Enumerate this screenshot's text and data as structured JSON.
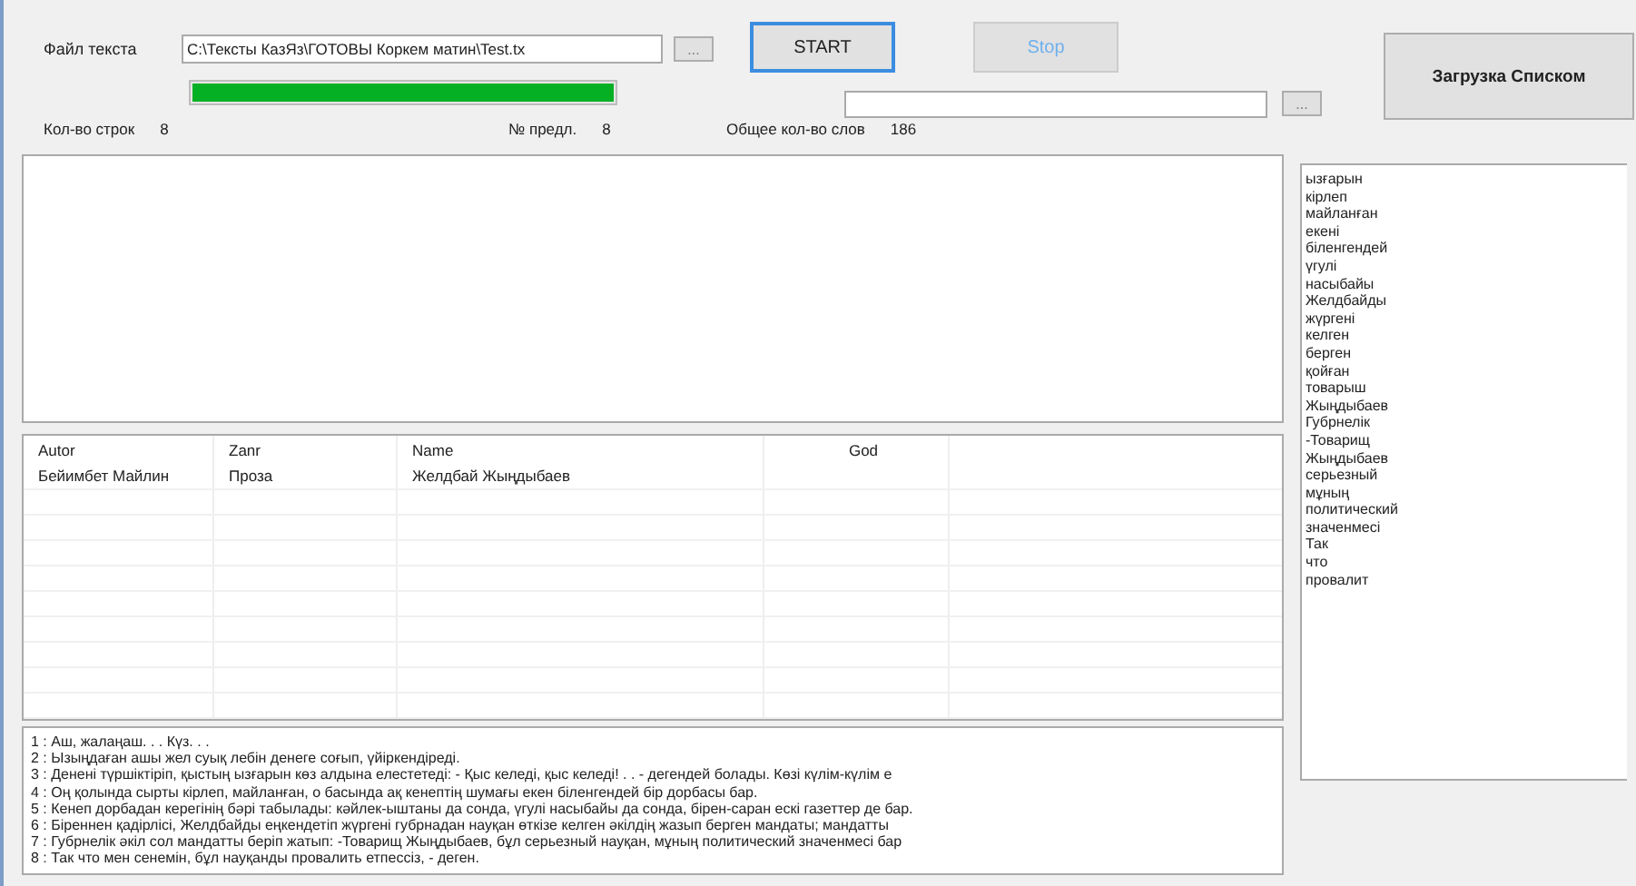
{
  "file_label": "Файл текста",
  "file_path": "C:\\Тексты КазЯз\\ГОТОВЫ Коркем матин\\Test.tx",
  "browse_button": "...",
  "buttons": [
    {
      "label": "START",
      "focused": true,
      "disabled": false
    },
    {
      "label": "Stop",
      "focused": false,
      "disabled": true
    }
  ],
  "load_list_button": "Загрузка Списком",
  "progress": {
    "level": 1
  },
  "list_browse_button": "...",
  "stats": [
    {
      "label": "Кол-во строк",
      "value": "8"
    },
    {
      "label": "№ предл.",
      "value": "8"
    },
    {
      "label": "Общее кол-во слов",
      "value": "186"
    }
  ],
  "table": {
    "columns": [
      "Autor",
      "Zanr",
      "Name",
      "God"
    ],
    "rows": [
      [
        "Бейимбет Майлин",
        "Проза",
        "Желдбай Жыңдыбаев",
        ""
      ]
    ]
  },
  "log_lines": [
    "1 : Аш, жалаңаш. . . Күз. . .",
    "2 : Ызыңдаған ашы жел суық лебін денеге соғып, үйіркендіреді.",
    "3 : Денені түршіктіріп, қыстың ызғарын көз алдына елестетеді:      - Қыс келеді, қыс келеді! . . - дегендей болады. Көзі күлім-күлім е",
    "4 : Оң қолында сырты кірлеп, майланған, о басында ақ кенептің шумағы екен біленгендей бір дорбасы бар.",
    "5 : Кенеп дорбадан керегінің бәрі табылады: кәйлек-ыштаны да сонда, үгулі насыбайы да сонда, бірен-саран ескі газеттер де бар.",
    "6 : Біреннен қадірлісі, Желдбайды          еңкендетіп жүргені губрнадан науқан өткізе келген әкілдің жазып берген мандаты; мандатты",
    "7 : Губрнелік әкіл сол мандатты беріп жатып:     -Товарищ Жыңдыбаев, бұл серьезный науқан, мұның политический значенмесі бар",
    "8 : Так что мен сенемін, бұл науқанды провалить етпессіз, - деген."
  ],
  "words": [
    "ызғарын",
    "кірлеп",
    "майланған",
    "екені",
    "біленгендей",
    "үгулі",
    "насыбайы",
    "Желдбайды",
    "жүргені",
    "келген",
    "берген",
    "қойған",
    "товарыш",
    "Жыңдыбаев",
    "Губрнелік",
    "-Товарищ",
    "Жыңдыбаев",
    "серьезный",
    "мұның",
    "политический",
    "значенмесі",
    "Так",
    "что",
    "провалит"
  ]
}
